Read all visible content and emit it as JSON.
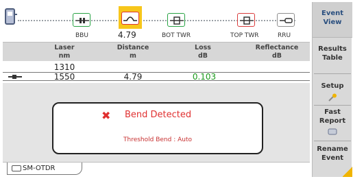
{
  "event_strip": {
    "events": [
      {
        "name": "BBU",
        "icon": "connector-icon",
        "color": "#27a243"
      },
      {
        "name": "",
        "icon": "bend-icon",
        "color": "#d33333",
        "selected": true
      },
      {
        "name": "BOT TWR",
        "icon": "splice-icon",
        "color": "#27a243"
      },
      {
        "name": "TOP TWR",
        "icon": "splice-icon",
        "color": "#d93b3b"
      },
      {
        "name": "RRU",
        "icon": "fiber-end-icon",
        "color": "#8f8f8f"
      }
    ],
    "selected_distance": "4.79"
  },
  "table": {
    "headers": [
      {
        "label": "Laser",
        "unit": "nm"
      },
      {
        "label": "Distance",
        "unit": "m"
      },
      {
        "label": "Loss",
        "unit": "dB"
      },
      {
        "label": "Reflectance",
        "unit": "dB"
      }
    ],
    "rows": [
      {
        "laser": "1310",
        "distance": "",
        "loss": "",
        "reflectance": ""
      },
      {
        "laser": "1550",
        "distance": "4.79",
        "loss": "0.103",
        "reflectance": ""
      }
    ]
  },
  "popup": {
    "title": "Bend Detected",
    "subtitle": "Threshold Bend : Auto",
    "icon": "red-x-icon"
  },
  "tab": {
    "label": "SM-OTDR"
  },
  "side_menu": {
    "event_view_line1": "Event",
    "event_view_line2": "View",
    "results_line1": "Results",
    "results_line2": "Table",
    "setup": "Setup",
    "fast_line1": "Fast",
    "fast_line2": "Report",
    "rename_line1": "Rename",
    "rename_line2": "Event"
  },
  "colors": {
    "selection_highlight": "#f7c61b",
    "accent_text": "#2a4f7f",
    "alert_red": "#e03030",
    "loss_green": "#1a9a1a"
  }
}
